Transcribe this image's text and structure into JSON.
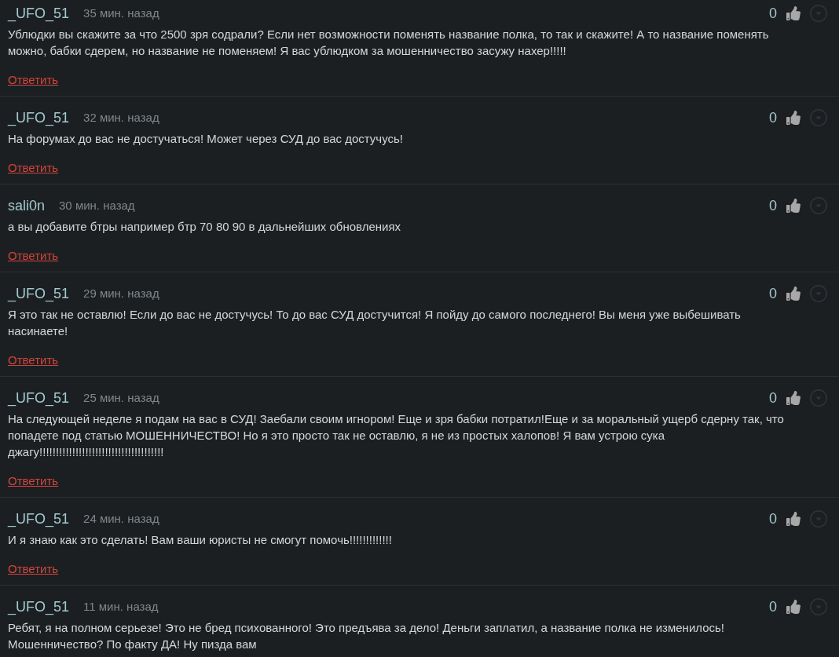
{
  "comments": [
    {
      "author": "_UFO_51",
      "time": "35 мин. назад",
      "votes": "0",
      "lines": [
        "Ублюдки вы скажите за что 2500 зря содрали? Если нет возможности поменять название полка, то так и скажите! А то название поменять",
        "можно, бабки сдерем, но название не поменяем! Я вас ублюдком за мошенничество засужу нахер!!!!!"
      ],
      "reply": "Ответить"
    },
    {
      "author": "_UFO_51",
      "time": "32 мин. назад",
      "votes": "0",
      "lines": [
        "На форумах до вас не достучаться! Может через СУД до вас достучусь!"
      ],
      "reply": "Ответить"
    },
    {
      "author": "sali0n",
      "time": "30 мин. назад",
      "votes": "0",
      "lines": [
        "а вы добавите бтры например бтр 70 80 90 в дальнейших обновлениях"
      ],
      "reply": "Ответить"
    },
    {
      "author": "_UFO_51",
      "time": "29 мин. назад",
      "votes": "0",
      "lines": [
        "Я это так не оставлю! Если до вас не достучусь! То до вас СУД достучится! Я пойду до самого последнего! Вы меня уже выбешивать",
        "насинаете!"
      ],
      "reply": "Ответить"
    },
    {
      "author": "_UFO_51",
      "time": "25 мин. назад",
      "votes": "0",
      "lines": [
        "На следующей неделе я подам на вас в СУД! Заебали своим игнором! Еще и зря бабки потратил!Еще и за моральный ущерб сдерну так, что",
        "попадете под статью МОШЕННИЧЕСТВО! Но я это просто так не оставлю, я не из простых халопов! Я вам устрою сука",
        "джагу!!!!!!!!!!!!!!!!!!!!!!!!!!!!!!!!!!!!!!"
      ],
      "reply": "Ответить"
    },
    {
      "author": "_UFO_51",
      "time": "24 мин. назад",
      "votes": "0",
      "lines": [
        "И я знаю как это сделать! Вам ваши юристы не смогут помочь!!!!!!!!!!!!!"
      ],
      "reply": "Ответить"
    },
    {
      "author": "_UFO_51",
      "time": "11 мин. назад",
      "votes": "0",
      "lines": [
        "Ребят, я на полном серьезе! Это не бред психованного! Это предъява за дело! Деньги заплатил, а название полка не изменилось!",
        "Мошенничество? По факту ДА! Ну пизда вам"
      ]
    }
  ]
}
